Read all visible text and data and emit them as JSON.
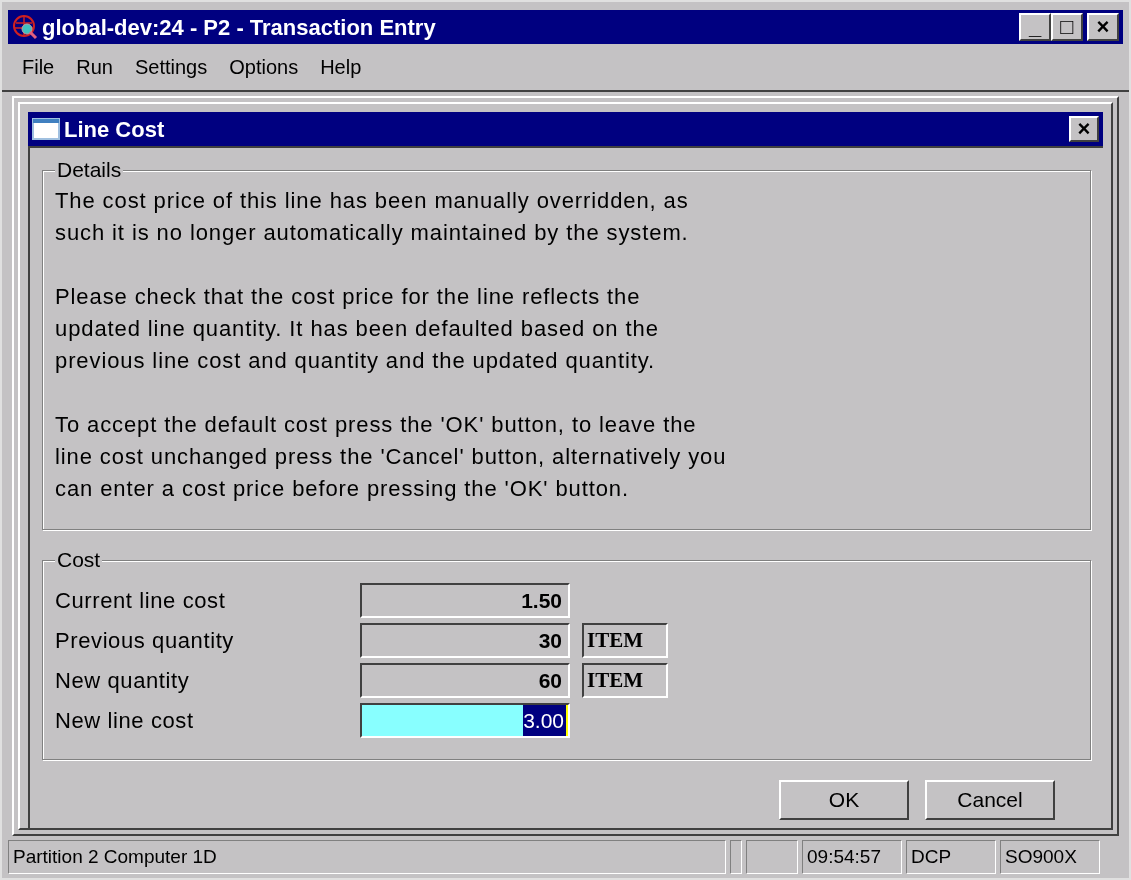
{
  "window": {
    "title": "global-dev:24 - P2 - Transaction Entry",
    "controls": [
      "_",
      "□",
      "×"
    ]
  },
  "menu": [
    "File",
    "Run",
    "Settings",
    "Options",
    "Help"
  ],
  "dialog": {
    "title": "Line Cost",
    "close": "×",
    "details": {
      "legend": "Details",
      "paragraphs": [
        "The cost price of this line has been manually overridden, as\nsuch it is no longer automatically maintained by the system.",
        "Please check that the cost price for the line reflects the\nupdated line quantity. It has been defaulted based on the\nprevious line cost and quantity and the updated quantity.",
        "To accept the default cost press the 'OK' button, to leave the\nline cost unchanged press the 'Cancel' button, alternatively you\ncan enter a cost price before pressing the 'OK' button."
      ]
    },
    "cost": {
      "legend": "Cost",
      "fields": [
        {
          "label": "Current line cost",
          "value": "1.50",
          "editable": false,
          "selected": false
        },
        {
          "label": "Previous quantity",
          "value": "30",
          "unit": "ITEM",
          "editable": false,
          "selected": false
        },
        {
          "label": "New quantity",
          "value": "60",
          "unit": "ITEM",
          "editable": false,
          "selected": false
        },
        {
          "label": "New line cost",
          "value": "3.00",
          "editable": true,
          "selected": true
        }
      ]
    },
    "buttons": [
      "OK",
      "Cancel"
    ]
  },
  "status_bar": {
    "message": "Partition 2 Computer 1D",
    "time": "09:54:57",
    "mode": "DCP",
    "program": "SO900X"
  }
}
